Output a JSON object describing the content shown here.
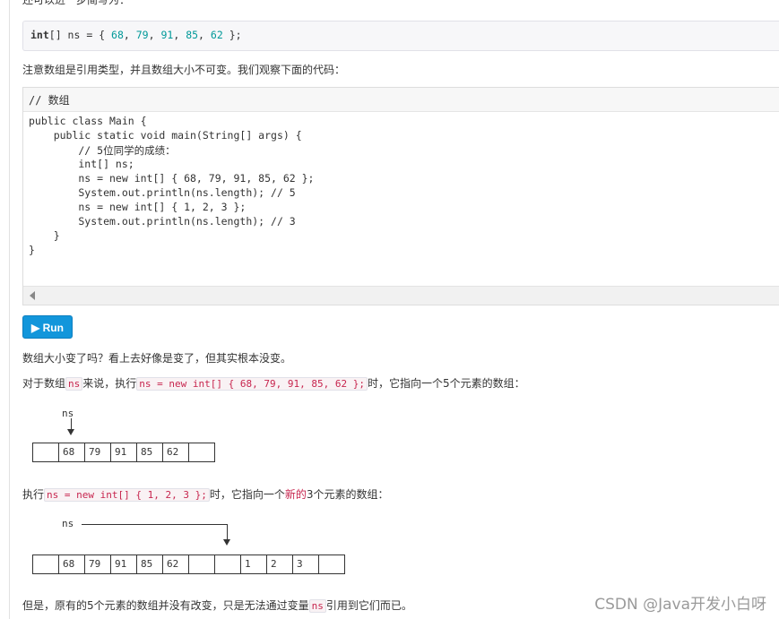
{
  "intro_text": "还可以进一步简写为：",
  "short_decl": {
    "kw": "int",
    "rest_a": "[] ns = { ",
    "nums": [
      "68",
      "79",
      "91",
      "85",
      "62"
    ],
    "rest_b": " };"
  },
  "note_text": "注意数组是引用类型，并且数组大小不可变。我们观察下面的代码：",
  "editor": {
    "header": "// 数组",
    "lines": [
      "public class Main {",
      "    public static void main(String[] args) {",
      "        // 5位同学的成绩：",
      "        int[] ns;",
      "        ns = new int[] { 68, 79, 91, 85, 62 };",
      "        System.out.println(ns.length); // 5",
      "        ns = new int[] { 1, 2, 3 };",
      "        System.out.println(ns.length); // 3",
      "    }",
      "}"
    ]
  },
  "run_label": "Run",
  "question_text": "数组大小变了吗？看上去好像是变了，但其实根本没变。",
  "p1": {
    "a": "对于数组",
    "code1": "ns",
    "b": "来说，执行",
    "code2": "ns = new int[] { 68, 79, 91, 85, 62 };",
    "c": "时，它指向一个5个元素的数组："
  },
  "diagram1": {
    "label": "ns",
    "cells": [
      "",
      "68",
      "79",
      "91",
      "85",
      "62",
      ""
    ]
  },
  "p2": {
    "a": "执行",
    "code": "ns = new int[] { 1, 2, 3 };",
    "b": "时，它指向一个",
    "hl": "新的",
    "c": "3个元素的数组："
  },
  "diagram2": {
    "label": "ns",
    "cells": [
      "",
      "68",
      "79",
      "91",
      "85",
      "62",
      "",
      "",
      "1",
      "2",
      "3",
      ""
    ]
  },
  "p3": {
    "a": "但是，原有的5个元素的数组并没有改变，只是无法通过变量",
    "code": "ns",
    "b": "引用到它们而已。"
  },
  "watermark": "CSDN @Java开发小白呀"
}
